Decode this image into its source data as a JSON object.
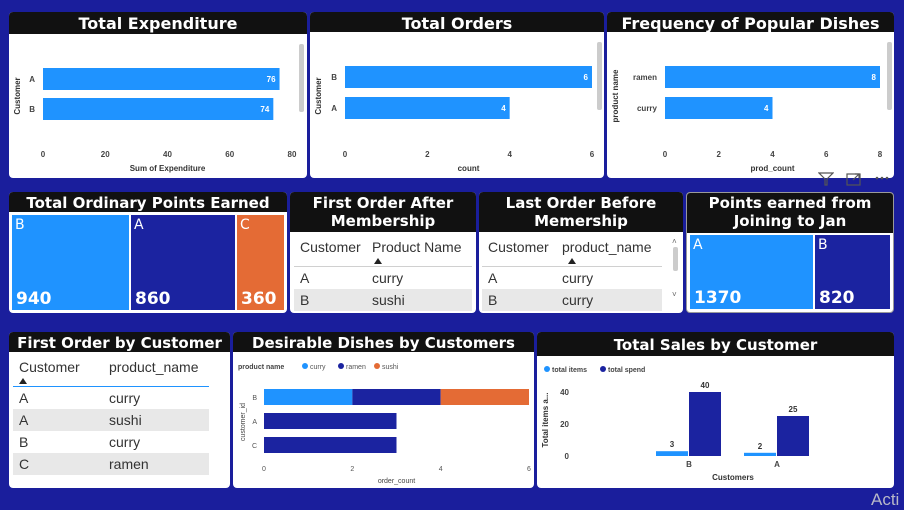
{
  "colors": {
    "background": "#1a1e9c",
    "accent_blue": "#1f93ff",
    "navy": "#1b23a0",
    "orange": "#e46b35",
    "title_bg": "#111111"
  },
  "cards": {
    "total_expenditure": {
      "title": "Total Expenditure"
    },
    "total_orders": {
      "title": "Total Orders"
    },
    "popular_dishes": {
      "title": "Frequency of Popular Dishes"
    },
    "ordinary_points": {
      "title": "Total Ordinary Points Earned"
    },
    "first_after": {
      "title": "First Order After Membership"
    },
    "last_before": {
      "title": "Last Order Before Memership"
    },
    "points_jan": {
      "title": "Points earned from Joining to Jan"
    },
    "first_by_customer": {
      "title": "First Order by Customer"
    },
    "desirable": {
      "title": "Desirable Dishes by Customers"
    },
    "total_sales": {
      "title": "Total Sales by Customer"
    }
  },
  "chart_data": [
    {
      "id": "expenditure",
      "type": "bar",
      "orientation": "horizontal",
      "categories": [
        "A",
        "B"
      ],
      "values": [
        76,
        74
      ],
      "xlabel": "Sum of Expenditure",
      "ylabel": "Customer",
      "xlim": [
        0,
        80
      ],
      "xticks": [
        0,
        20,
        40,
        60,
        80
      ],
      "color": "#1f93ff"
    },
    {
      "id": "orders",
      "type": "bar",
      "orientation": "horizontal",
      "categories": [
        "B",
        "A"
      ],
      "values": [
        6,
        4
      ],
      "xlabel": "count",
      "ylabel": "Customer",
      "xlim": [
        0,
        6
      ],
      "xticks": [
        0,
        2,
        4,
        6
      ],
      "color": "#1f93ff"
    },
    {
      "id": "popular",
      "type": "bar",
      "orientation": "horizontal",
      "categories": [
        "ramen",
        "curry"
      ],
      "values": [
        8,
        4
      ],
      "xlabel": "prod_count",
      "ylabel": "product name",
      "xlim": [
        0,
        8
      ],
      "xticks": [
        0,
        2,
        4,
        6,
        8
      ],
      "color": "#1f93ff"
    },
    {
      "id": "desirable",
      "type": "bar",
      "orientation": "horizontal",
      "stacked": true,
      "categories": [
        "B",
        "A",
        "C"
      ],
      "xlabel": "order_count",
      "ylabel": "customer_id",
      "xlim": [
        0,
        6
      ],
      "xticks": [
        0,
        2,
        4,
        6
      ],
      "legend_title": "product name",
      "legend_position": "top-left",
      "series": [
        {
          "name": "curry",
          "color": "#1f93ff",
          "values": [
            2,
            0,
            0
          ]
        },
        {
          "name": "ramen",
          "color": "#1b23a0",
          "values": [
            2,
            3,
            3
          ]
        },
        {
          "name": "sushi",
          "color": "#e46b35",
          "values": [
            2,
            0,
            0
          ]
        }
      ]
    },
    {
      "id": "sales",
      "type": "bar",
      "orientation": "vertical",
      "categories": [
        "B",
        "A"
      ],
      "xlabel": "Customers",
      "ylabel": "Total items a...",
      "ylim": [
        0,
        45
      ],
      "yticks": [
        0,
        20,
        40
      ],
      "legend_position": "top-left",
      "series": [
        {
          "name": "total items",
          "color": "#1f93ff",
          "values": [
            3,
            2
          ]
        },
        {
          "name": "total spend",
          "color": "#1b23a0",
          "values": [
            40,
            25
          ]
        }
      ]
    }
  ],
  "ordinary_points": {
    "tiles": [
      {
        "label": "B",
        "value": "940",
        "color": "#1f93ff"
      },
      {
        "label": "A",
        "value": "860",
        "color": "#1b23a0"
      },
      {
        "label": "C",
        "value": "360",
        "color": "#e46b35"
      }
    ]
  },
  "points_jan": {
    "tiles": [
      {
        "label": "A",
        "value": "1370",
        "color": "#1f93ff"
      },
      {
        "label": "B",
        "value": "820",
        "color": "#1b23a0"
      }
    ]
  },
  "first_after": {
    "headers": [
      "Customer",
      "Product Name"
    ],
    "rows": [
      [
        "A",
        "curry"
      ],
      [
        "B",
        "sushi"
      ]
    ]
  },
  "last_before": {
    "headers": [
      "Customer",
      "product_name"
    ],
    "rows": [
      [
        "A",
        "curry"
      ],
      [
        "B",
        "curry"
      ]
    ]
  },
  "first_by_customer": {
    "headers": [
      "Customer",
      "product_name"
    ],
    "rows": [
      [
        "A",
        "curry"
      ],
      [
        "A",
        "sushi"
      ],
      [
        "B",
        "curry"
      ],
      [
        "C",
        "ramen"
      ]
    ]
  },
  "toolbar_icons": [
    "filter-icon",
    "focus-mode-icon",
    "more-options-icon"
  ],
  "watermark": "Acti"
}
